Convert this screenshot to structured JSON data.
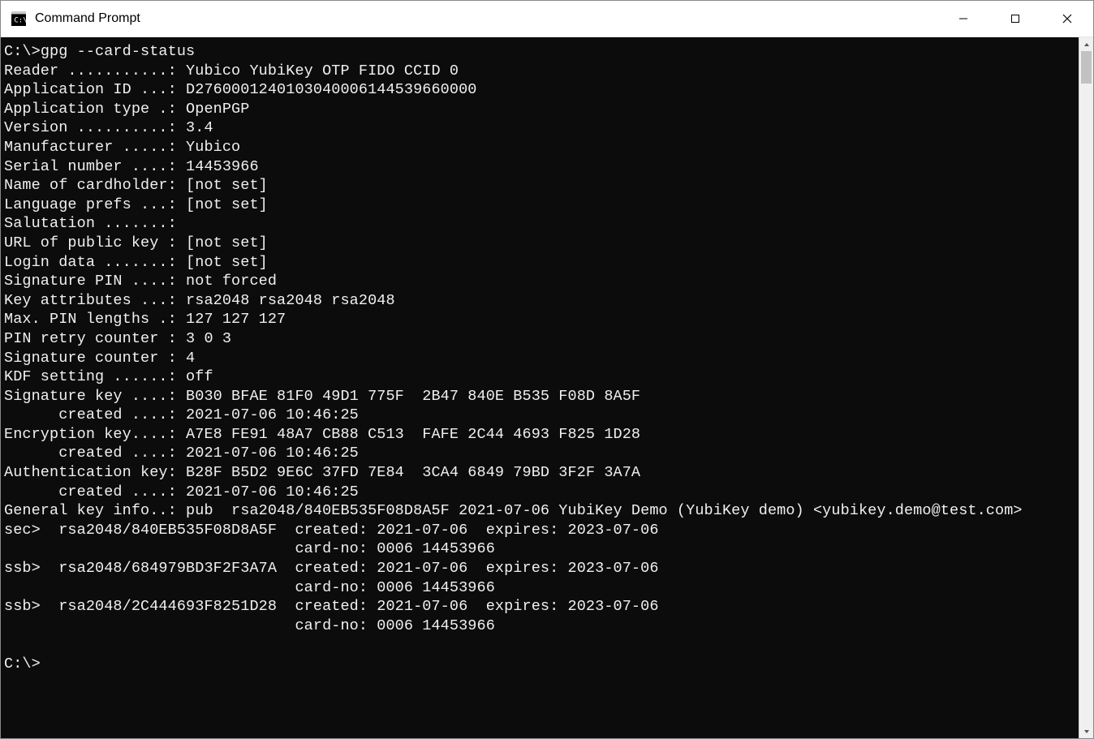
{
  "window": {
    "title": "Command Prompt"
  },
  "terminal": {
    "prompt1": "C:\\>",
    "command1": "gpg --card-status",
    "lines": {
      "reader": "Reader ...........: Yubico YubiKey OTP FIDO CCID 0",
      "app_id": "Application ID ...: D2760001240103040006144539660000",
      "app_type": "Application type .: OpenPGP",
      "version": "Version ..........: 3.4",
      "manufacturer": "Manufacturer .....: Yubico",
      "serial": "Serial number ....: 14453966",
      "cardholder": "Name of cardholder: [not set]",
      "lang": "Language prefs ...: [not set]",
      "salutation": "Salutation .......:",
      "url": "URL of public key : [not set]",
      "login": "Login data .......: [not set]",
      "sig_pin": "Signature PIN ....: not forced",
      "key_attr": "Key attributes ...: rsa2048 rsa2048 rsa2048",
      "max_pin": "Max. PIN lengths .: 127 127 127",
      "pin_retry": "PIN retry counter : 3 0 3",
      "sig_counter": "Signature counter : 4",
      "kdf": "KDF setting ......: off",
      "sig_key": "Signature key ....: B030 BFAE 81F0 49D1 775F  2B47 840E B535 F08D 8A5F",
      "sig_key_c": "      created ....: 2021-07-06 10:46:25",
      "enc_key": "Encryption key....: A7E8 FE91 48A7 CB88 C513  FAFE 2C44 4693 F825 1D28",
      "enc_key_c": "      created ....: 2021-07-06 10:46:25",
      "auth_key": "Authentication key: B28F B5D2 9E6C 37FD 7E84  3CA4 6849 79BD 3F2F 3A7A",
      "auth_key_c": "      created ....: 2021-07-06 10:46:25",
      "gen_info": "General key info..: pub  rsa2048/840EB535F08D8A5F 2021-07-06 YubiKey Demo (YubiKey demo) <yubikey.demo@test.com>",
      "sec": "sec>  rsa2048/840EB535F08D8A5F  created: 2021-07-06  expires: 2023-07-06",
      "sec_card": "                                card-no: 0006 14453966",
      "ssb1": "ssb>  rsa2048/684979BD3F2F3A7A  created: 2021-07-06  expires: 2023-07-06",
      "ssb1_card": "                                card-no: 0006 14453966",
      "ssb2": "ssb>  rsa2048/2C444693F8251D28  created: 2021-07-06  expires: 2023-07-06",
      "ssb2_card": "                                card-no: 0006 14453966"
    },
    "prompt2": "C:\\>"
  }
}
